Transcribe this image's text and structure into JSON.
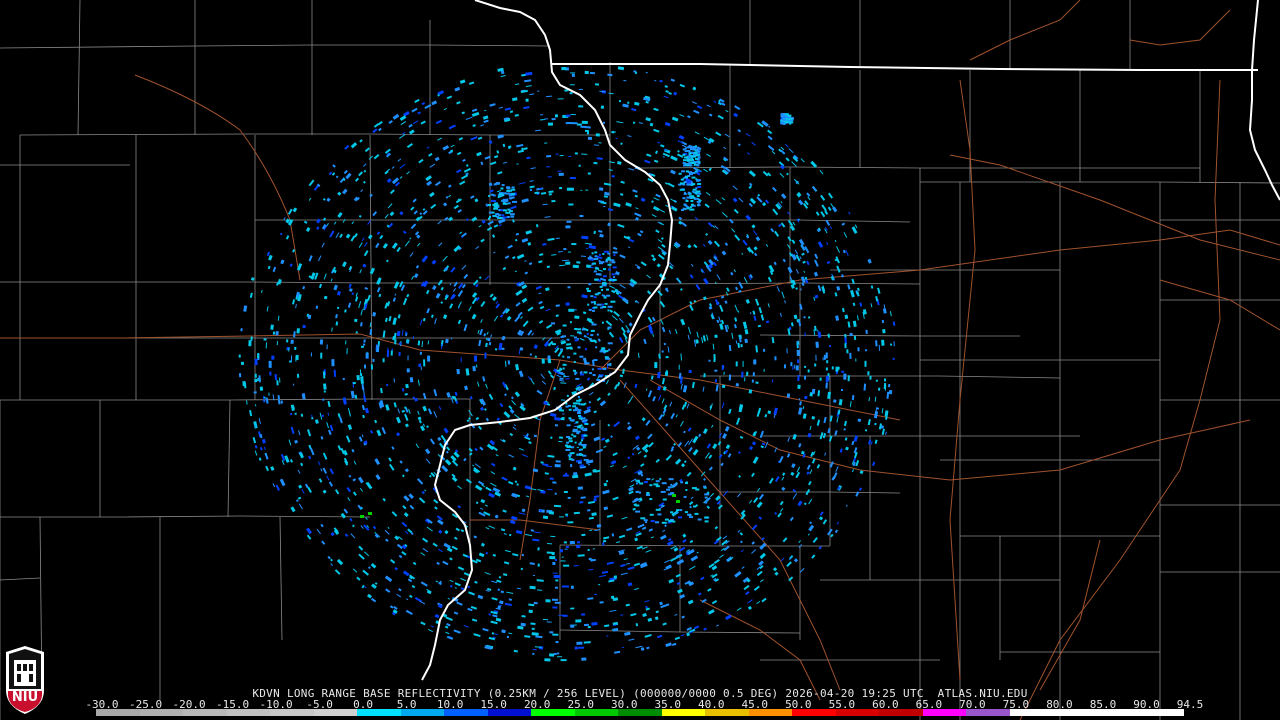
{
  "caption": "KDVN LONG RANGE BASE REFLECTIVITY (0.25KM / 256 LEVEL) (000000/0000 0.5 DEG) 2026-04-20 19:25 UTC  ATLAS.NIU.EDU",
  "logo_text": "NIU",
  "scale": {
    "labels": [
      "-30.0",
      "-25.0",
      "-20.0",
      "-15.0",
      "-10.0",
      "-5.0",
      "0.0",
      "5.0",
      "10.0",
      "15.0",
      "20.0",
      "25.0",
      "30.0",
      "35.0",
      "40.0",
      "45.0",
      "50.0",
      "55.0",
      "60.0",
      "65.0",
      "70.0",
      "75.0",
      "80.0",
      "85.0",
      "90.0",
      "94.5"
    ],
    "colors": [
      "#a8a8a8",
      "#b0b0b0",
      "#b8b8b8",
      "#c0c0c0",
      "#c8c8c8",
      "#d0d0d0",
      "#00e0ff",
      "#00a8f0",
      "#0060ff",
      "#0010d0",
      "#00ff00",
      "#00c800",
      "#008c00",
      "#ffff00",
      "#e8c000",
      "#ff9000",
      "#ff0000",
      "#d60000",
      "#c00000",
      "#ff00ff",
      "#9955c9",
      "#ffffff",
      "#ffffff",
      "#ffffff",
      "#ffffff"
    ]
  },
  "colors": {
    "state_border": "#ffffff",
    "county_border": "#8a8a8a",
    "highway": "#a0522d",
    "radar_light": "#00c8e8",
    "radar_mid": "#1e90ff",
    "radar_dark": "#0040ff",
    "radar_green": "#00d000"
  }
}
